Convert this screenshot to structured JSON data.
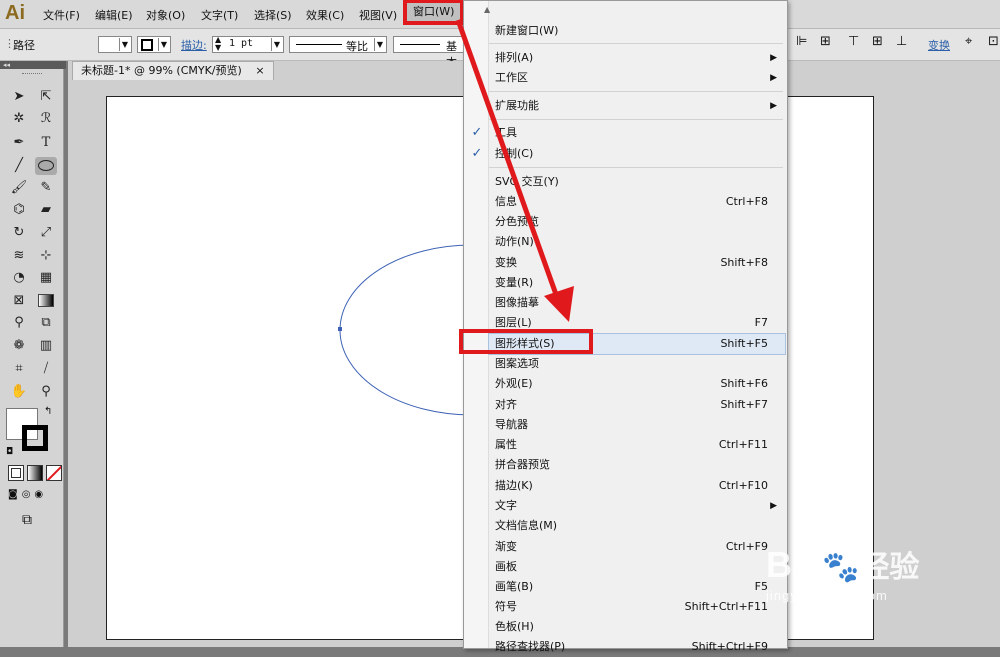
{
  "app": {
    "logo": "Ai"
  },
  "menubar": {
    "items": [
      "文件(F)",
      "编辑(E)",
      "对象(O)",
      "文字(T)",
      "选择(S)",
      "效果(C)",
      "视图(V)",
      "窗口(W)"
    ]
  },
  "control": {
    "path_label": "路径",
    "stroke_label": "描边:",
    "stroke_value": "1 pt",
    "profile_label": "等比",
    "brush_label": "基本",
    "transform_label": "变换"
  },
  "document": {
    "tab_title": "未标题-1* @ 99% (CMYK/预览)",
    "tab_close": "×"
  },
  "window_menu": {
    "items": [
      {
        "label": "新建窗口(W)",
        "shortcut": ""
      },
      {
        "label": "排列(A)",
        "shortcut": "",
        "submenu": true
      },
      {
        "label": "工作区",
        "shortcut": "",
        "submenu": true
      },
      {
        "label": "扩展功能",
        "shortcut": "",
        "submenu": true
      },
      {
        "label": "工具",
        "shortcut": "",
        "checked": true
      },
      {
        "label": "控制(C)",
        "shortcut": "",
        "checked": true
      },
      {
        "label": "SVG 交互(Y)",
        "shortcut": ""
      },
      {
        "label": "信息",
        "shortcut": "Ctrl+F8"
      },
      {
        "label": "分色预览",
        "shortcut": ""
      },
      {
        "label": "动作(N)",
        "shortcut": ""
      },
      {
        "label": "变换",
        "shortcut": "Shift+F8"
      },
      {
        "label": "变量(R)",
        "shortcut": ""
      },
      {
        "label": "图像描摹",
        "shortcut": ""
      },
      {
        "label": "图层(L)",
        "shortcut": "F7"
      },
      {
        "label": "图形样式(S)",
        "shortcut": "Shift+F5",
        "highlighted": true
      },
      {
        "label": "图案选项",
        "shortcut": ""
      },
      {
        "label": "外观(E)",
        "shortcut": "Shift+F6"
      },
      {
        "label": "对齐",
        "shortcut": "Shift+F7"
      },
      {
        "label": "导航器",
        "shortcut": ""
      },
      {
        "label": "属性",
        "shortcut": "Ctrl+F11"
      },
      {
        "label": "拼合器预览",
        "shortcut": ""
      },
      {
        "label": "描边(K)",
        "shortcut": "Ctrl+F10"
      },
      {
        "label": "文字",
        "shortcut": "",
        "submenu": true
      },
      {
        "label": "文档信息(M)",
        "shortcut": ""
      },
      {
        "label": "渐变",
        "shortcut": "Ctrl+F9"
      },
      {
        "label": "画板",
        "shortcut": ""
      },
      {
        "label": "画笔(B)",
        "shortcut": "F5"
      },
      {
        "label": "符号",
        "shortcut": "Shift+Ctrl+F11"
      },
      {
        "label": "色板(H)",
        "shortcut": ""
      },
      {
        "label": "路径查找器(P)",
        "shortcut": "Shift+Ctrl+F9"
      }
    ]
  },
  "watermark": {
    "brand": "Bai",
    "brand2": "经验",
    "url": "jingyan.baidu.com"
  },
  "colors": {
    "highlight_red": "#e0191c",
    "ellipse_stroke": "#3d62b5",
    "check_blue": "#2a5fa8"
  }
}
